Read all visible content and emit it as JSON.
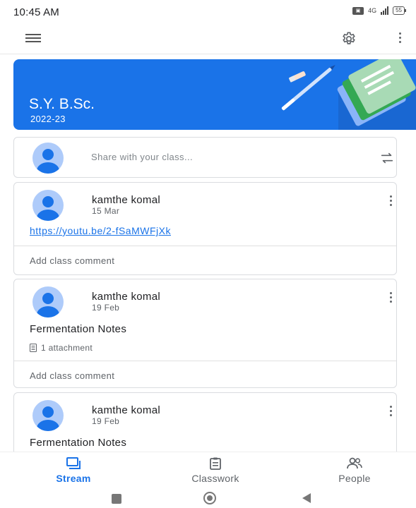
{
  "status_bar": {
    "time": "10:45 AM",
    "network": "4G",
    "battery": "55"
  },
  "app_bar": {
    "menu_icon": "hamburger-menu-icon",
    "settings_icon": "settings-gear-icon",
    "more_icon": "more-vert-icon"
  },
  "banner": {
    "title": "S.Y. B.Sc.",
    "subtitle": "2022-23",
    "color": "#1a73e8"
  },
  "share": {
    "placeholder": "Share with your class...",
    "icon": "repost-icon"
  },
  "posts": [
    {
      "author": "kamthe komal",
      "date": "15 Mar",
      "link": "https://youtu.be/2-fSaMWFjXk",
      "comment_label": "Add class comment"
    },
    {
      "author": "kamthe komal",
      "date": "19 Feb",
      "body": "Fermentation Notes",
      "attachment": "1 attachment",
      "comment_label": "Add class comment"
    },
    {
      "author": "kamthe komal",
      "date": "19 Feb",
      "body": "Fermentation Notes"
    }
  ],
  "bottom_nav": [
    {
      "label": "Stream",
      "icon": "stream-icon",
      "active": true
    },
    {
      "label": "Classwork",
      "icon": "classwork-icon",
      "active": false
    },
    {
      "label": "People",
      "icon": "people-icon",
      "active": false
    }
  ],
  "accent_color": "#1a73e8"
}
